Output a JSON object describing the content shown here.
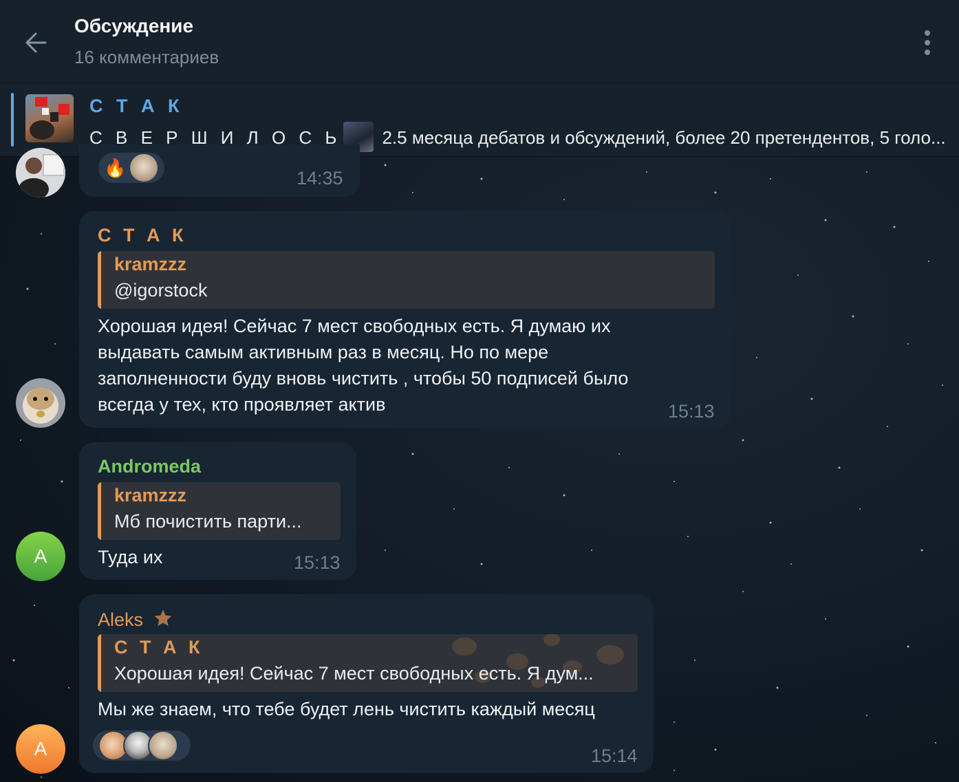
{
  "header": {
    "title": "Обсуждение",
    "subtitle": "16 комментариев"
  },
  "pinned": {
    "title": "С Т А К",
    "prefix": "С В Е Р Ш И Л О С Ь",
    "text": "2.5 месяца дебатов и обсуждений, более 20 претендентов, 5 голо..."
  },
  "messages": [
    {
      "time": "14:35",
      "reactions": [
        "fire-emoji",
        "hamster-avatar"
      ],
      "reaction_fire": "🔥"
    },
    {
      "author": "С Т А К",
      "author_color": "#e59a55",
      "quote_author": "kramzzz",
      "quote_text": "@igorstock",
      "lines": [
        "Хорошая идея! Сейчас 7 мест свободных есть. Я думаю их",
        "выдавать самым активным раз в месяц. Но по мере",
        "заполненности буду вновь чистить , чтобы 50 подписей было",
        "всегда у тех, кто проявляет актив"
      ],
      "time": "15:13"
    },
    {
      "author": "Andromeda",
      "author_color": "#7bc862",
      "avatar_letter": "A",
      "quote_author": "kramzzz",
      "quote_text": "Мб почистить парти...",
      "text": "Туда их",
      "time": "15:13"
    },
    {
      "author": "Aleks",
      "author_color": "#e59a55",
      "author_badge": "star-icon",
      "avatar_letter": "A",
      "quote_author": "С Т А К",
      "quote_text": "Хорошая идея! Сейчас 7 мест свободных есть. Я дум...",
      "text": "Мы же знаем, что тебе будет лень чистить каждый месяц",
      "time": "15:14"
    }
  ],
  "colors": {
    "header_bg": "#17212b",
    "bubble_bg": "#182533",
    "accent_blue": "#5ea8e6",
    "quote_orange": "#e59a55",
    "green": "#7bc862"
  }
}
